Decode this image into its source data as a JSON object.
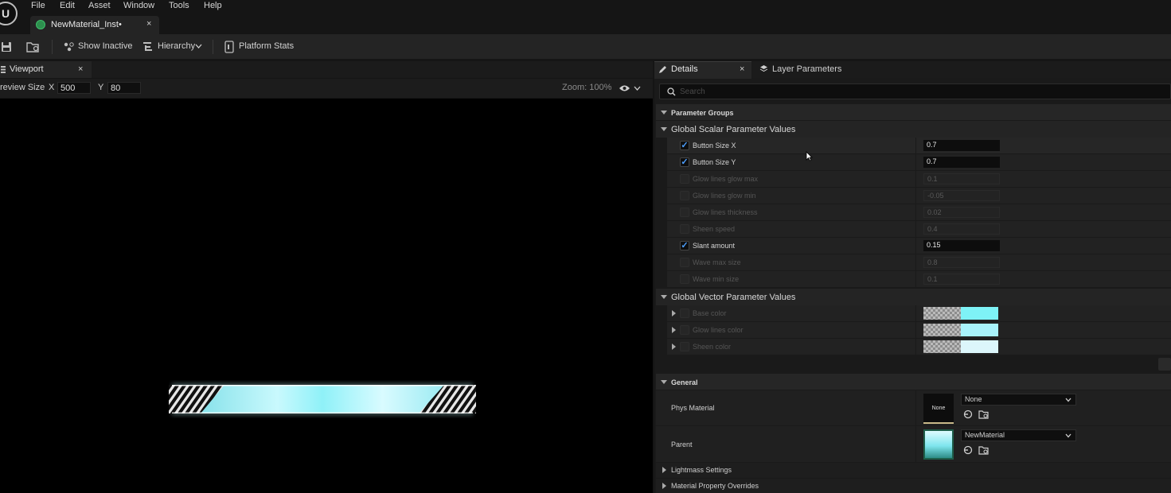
{
  "menu": [
    "File",
    "Edit",
    "Asset",
    "Window",
    "Tools",
    "Help"
  ],
  "asset_tab": {
    "label": "NewMaterial_Inst•",
    "close": "×"
  },
  "toolbar": {
    "show_inactive": "Show Inactive",
    "hierarchy": "Hierarchy",
    "platform_stats": "Platform Stats"
  },
  "viewport": {
    "tab_label": "Viewport",
    "close": "×",
    "preview_size_label": "review Size",
    "x_label": "X",
    "x_value": "500",
    "y_label": "Y",
    "y_value": "80",
    "zoom": "Zoom: 100%"
  },
  "details": {
    "tab_label": "Details",
    "close": "×",
    "layer_tab_label": "Layer Parameters",
    "search_placeholder": "Search",
    "parameter_groups": "Parameter Groups",
    "scalar_title": "Global Scalar Parameter Values",
    "scalar_params": [
      {
        "name": "Button Size X",
        "value": "0.7",
        "enabled": true
      },
      {
        "name": "Button Size Y",
        "value": "0.7",
        "enabled": true
      },
      {
        "name": "Glow lines glow max",
        "value": "0.1",
        "enabled": false
      },
      {
        "name": "Glow lines glow min",
        "value": "-0.05",
        "enabled": false
      },
      {
        "name": "Glow lines thickness",
        "value": "0.02",
        "enabled": false
      },
      {
        "name": "Sheen speed",
        "value": "0.4",
        "enabled": false
      },
      {
        "name": "Slant amount",
        "value": "0.15",
        "enabled": true
      },
      {
        "name": "Wave max size",
        "value": "0.8",
        "enabled": false
      },
      {
        "name": "Wave min size",
        "value": "0.1",
        "enabled": false
      }
    ],
    "vector_title": "Global Vector Parameter Values",
    "vector_params": [
      {
        "name": "Base color",
        "color": "#7ef2f6"
      },
      {
        "name": "Glow lines color",
        "color": "#a8f2fa"
      },
      {
        "name": "Sheen color",
        "color": "#dcf6fb"
      }
    ],
    "general_title": "General",
    "phys_material_label": "Phys Material",
    "phys_material_thumb": "None",
    "phys_material_value": "None",
    "parent_label": "Parent",
    "parent_value": "NewMaterial",
    "lightmass_settings": "Lightmass Settings",
    "material_property_overrides": "Material Property Overrides"
  },
  "colors": {
    "checkbox_accent": "#4d9fff",
    "glow_cyan": "#9ff4fb"
  }
}
